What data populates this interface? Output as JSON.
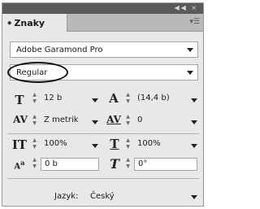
{
  "titlebar": {
    "controls": "◀◀ ×"
  },
  "tab": {
    "label": "Znaky",
    "arrows": "◆",
    "menu": "▾☰"
  },
  "font_family": {
    "value": "Adobe Garamond Pro"
  },
  "font_style": {
    "value": "Regular"
  },
  "font_size": {
    "value": "12 b"
  },
  "leading": {
    "value": "(14,4 b)"
  },
  "kerning": {
    "value": "Z metrik"
  },
  "tracking": {
    "value": "0"
  },
  "vertical_scale": {
    "value": "100%"
  },
  "horizontal_scale": {
    "value": "100%"
  },
  "baseline_shift": {
    "value": "0 b"
  },
  "skew": {
    "value": "0°"
  },
  "language": {
    "label": "Jazyk:",
    "value": "Český"
  }
}
